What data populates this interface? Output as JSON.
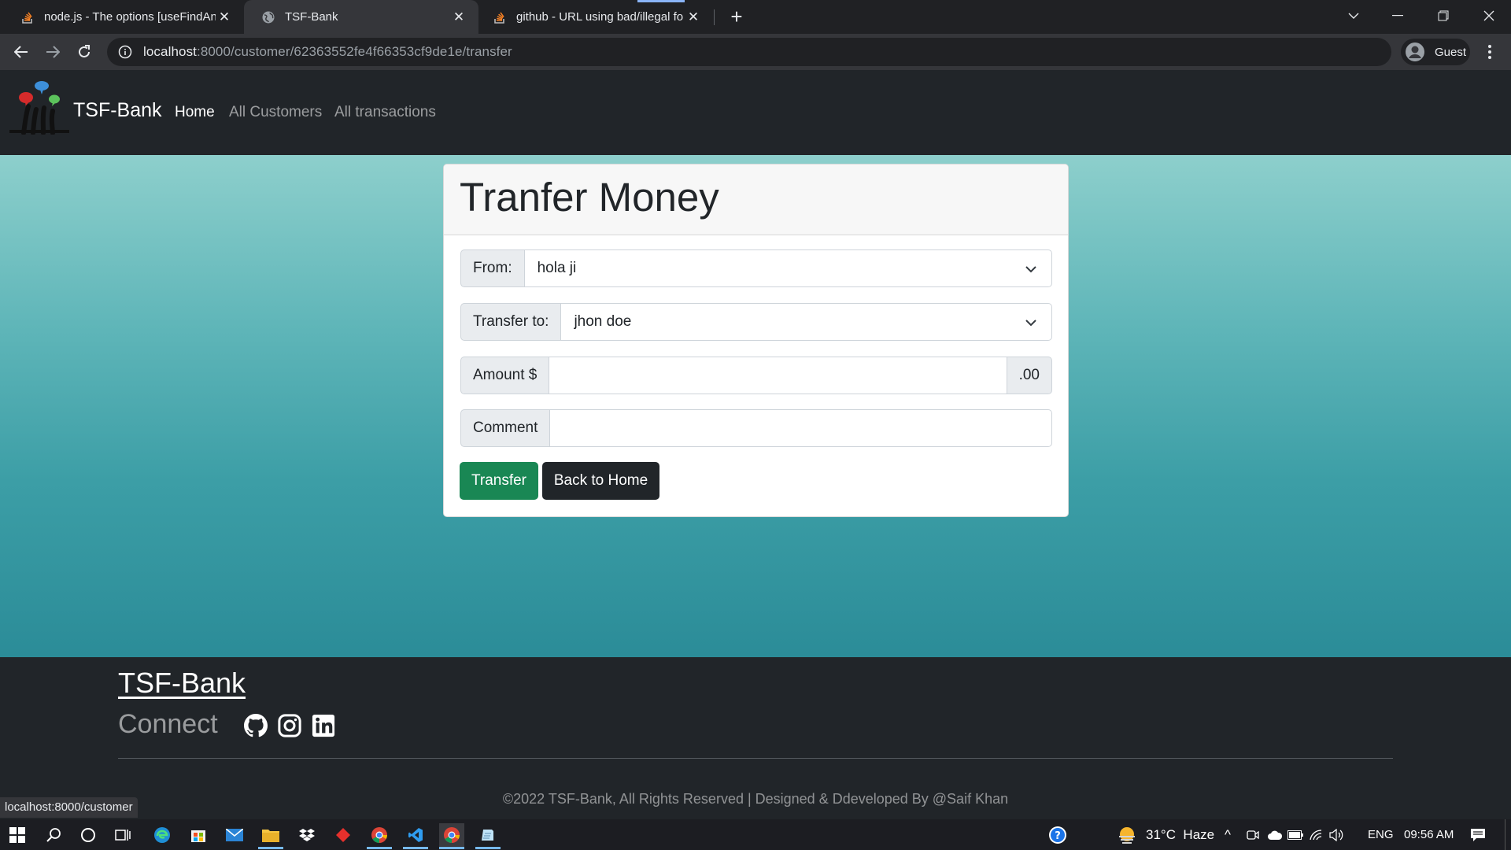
{
  "browser": {
    "tabs": [
      {
        "title": "node.js - The options [useFindAn",
        "active": false
      },
      {
        "title": "TSF-Bank",
        "active": true
      },
      {
        "title": "github - URL using bad/illegal fo",
        "active": false
      }
    ],
    "url_host": "localhost",
    "url_path": ":8000/customer/62363552fe4f66353cf9de1e/transfer",
    "profile_label": "Guest",
    "status_url": "localhost:8000/customer"
  },
  "site": {
    "brand": "TSF-Bank",
    "nav": [
      {
        "label": "Home",
        "active": true
      },
      {
        "label": "All Customers",
        "active": false
      },
      {
        "label": "All transactions",
        "active": false
      }
    ]
  },
  "transfer_form": {
    "title": "Tranfer Money",
    "from_label": "From:",
    "from_value": "hola ji",
    "to_label": "Transfer to:",
    "to_value": "jhon doe",
    "amount_label": "Amount $",
    "amount_value": "",
    "amount_suffix": ".00",
    "comment_label": "Comment",
    "comment_value": "",
    "transfer_button": "Transfer",
    "home_button": "Back to Home"
  },
  "footer": {
    "brand": "TSF-Bank",
    "connect": "Connect",
    "social_icons": [
      "github-icon",
      "instagram-icon",
      "linkedin-icon"
    ],
    "copyright": "©2022 TSF-Bank, All Rights Reserved | Designed & Ddeveloped By @Saif Khan"
  },
  "taskbar": {
    "weather": "31°C  Haze",
    "language": "ENG",
    "time": "09:56 AM"
  },
  "colors": {
    "navbar": "#212529",
    "success": "#198754",
    "hero_top": "#8dcfcc",
    "hero_bottom": "#2b8c98"
  }
}
